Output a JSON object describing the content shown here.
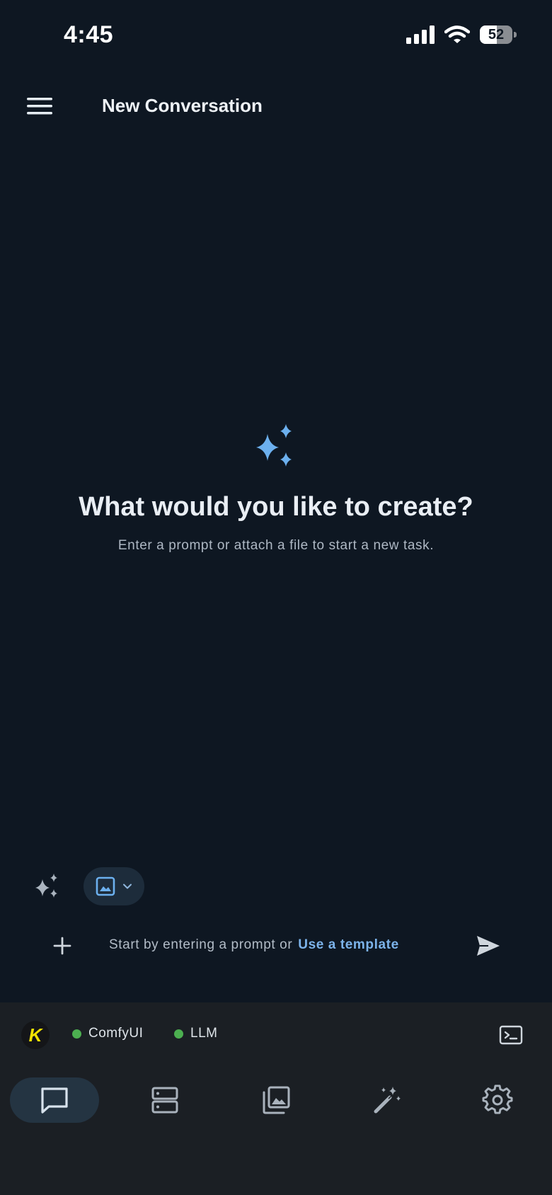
{
  "status_bar": {
    "time": "4:45",
    "battery_level": "52",
    "battery_fraction": 0.52
  },
  "header": {
    "title": "New Conversation"
  },
  "hero": {
    "heading": "What would you like to create?",
    "subtitle": "Enter a prompt or attach a file to start a new task."
  },
  "composer": {
    "placeholder": "Start by entering a prompt or",
    "template_link": "Use a template"
  },
  "connections": [
    {
      "label": "ComfyUI",
      "status_color": "#4caf50"
    },
    {
      "label": "LLM",
      "status_color": "#4caf50"
    }
  ],
  "logo": {
    "letter": "K"
  },
  "bottom_nav": {
    "active": "chat",
    "items": [
      "chat-icon",
      "servers-icon",
      "gallery-icon",
      "magic-wand-icon",
      "settings-icon"
    ]
  },
  "colors": {
    "background": "#0e1722",
    "accent": "#7cb3ea",
    "panel": "#1b1f24",
    "online": "#4caf50"
  }
}
